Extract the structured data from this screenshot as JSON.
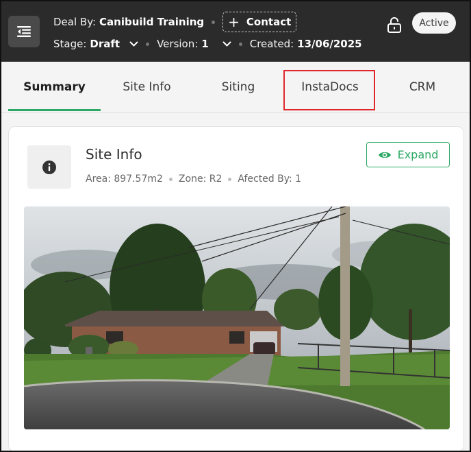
{
  "header": {
    "deal_by_label": "Deal By:",
    "deal_by_value": "Canibuild Training",
    "contact_label": "Contact",
    "stage_label": "Stage:",
    "stage_value": "Draft",
    "version_label": "Version:",
    "version_value": "1",
    "created_label": "Created:",
    "created_value": "13/06/2025",
    "status_badge": "Active"
  },
  "tabs": [
    {
      "label": "Summary",
      "active": true
    },
    {
      "label": "Site Info",
      "active": false
    },
    {
      "label": "Siting",
      "active": false
    },
    {
      "label": "InstaDocs",
      "active": false,
      "highlighted": true
    },
    {
      "label": "CRM",
      "active": false
    }
  ],
  "site_info": {
    "title": "Site Info",
    "area": "Area: 897.57m2",
    "zone": "Zone: R2",
    "affected_by": "Afected By: 1",
    "expand_label": "Expand"
  },
  "colors": {
    "header_bg": "#2b2b2b",
    "accent_green": "#2ba863",
    "highlight_red": "#e0262b"
  },
  "icons": [
    "menu-collapse-icon",
    "plus-icon",
    "chevron-down-icon",
    "unlock-icon",
    "info-icon",
    "eye-icon"
  ]
}
